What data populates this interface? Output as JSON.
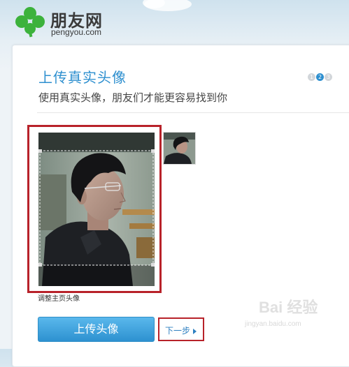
{
  "header": {
    "logo_name": "朋友网",
    "logo_domain": "pengyou.com"
  },
  "page": {
    "title": "上传真实头像",
    "subtitle": "使用真实头像，朋友们才能更容易找到你"
  },
  "steps": {
    "items": [
      "1",
      "2",
      "3"
    ],
    "current": 2
  },
  "photo": {
    "adjust_label": "调整主页头像"
  },
  "actions": {
    "upload_label": "上传头像",
    "next_label": "下一步"
  },
  "watermark": {
    "text": "Bai 经验",
    "url": "jingyan.baidu.com"
  },
  "colors": {
    "accent": "#2d8fcf",
    "highlight_frame": "#b8222a",
    "logo_green": "#3cb23c"
  }
}
